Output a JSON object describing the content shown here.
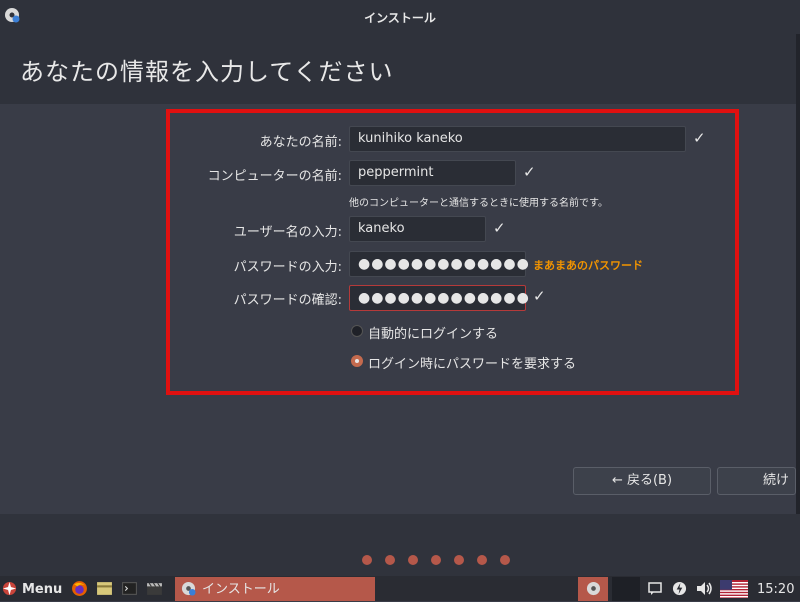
{
  "window": {
    "title": "インストール"
  },
  "page": {
    "heading": "あなたの情報を入力してください"
  },
  "form": {
    "name_label": "あなたの名前:",
    "name_value": "kunihiko kaneko",
    "computer_label": "コンピューターの名前:",
    "computer_value": "peppermint",
    "computer_hint": "他のコンピューターと通信するときに使用する名前です。",
    "username_label": "ユーザー名の入力:",
    "username_value": "kaneko",
    "password_label": "パスワードの入力:",
    "password_value": "●●●●●●●●●●●●●",
    "password_strength": "まあまあのパスワード",
    "confirm_label": "パスワードの確認:",
    "confirm_value": "●●●●●●●●●●●●●",
    "autologin_label": "自動的にログインする",
    "require_password_label": "ログイン時にパスワードを要求する",
    "check_glyph": "✓"
  },
  "buttons": {
    "back": "← 戻る(B)",
    "continue": "続け"
  },
  "taskbar": {
    "menu": "Menu",
    "task_label": "インストール",
    "time": "15:20"
  },
  "colors": {
    "highlight": "#e01010",
    "accent": "#b5584a",
    "strength": "#f29400"
  }
}
